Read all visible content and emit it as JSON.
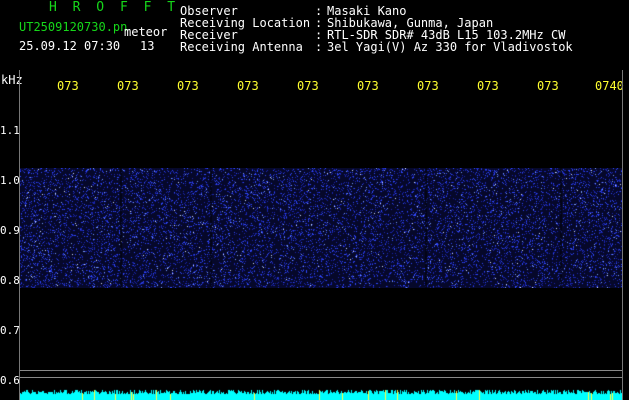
{
  "header": {
    "logo": "H R O F F T",
    "filename": "UT2509120730.pn",
    "meteor_label": "meteor",
    "date": "25.09.12 07:30",
    "count": "13",
    "info": [
      {
        "label": "Observer",
        "value": "Masaki Kano"
      },
      {
        "label": "Receiving Location",
        "value": "Shibukawa, Gunma, Japan"
      },
      {
        "label": "Receiver",
        "value": "RTL-SDR SDR# 43dB L15 103.2MHz CW"
      },
      {
        "label": "Receiving Antenna",
        "value": "3el Yagi(V) Az 330 for Vladivostok"
      }
    ]
  },
  "axes": {
    "unit": "kHz",
    "time_ticks": [
      "073",
      "073",
      "073",
      "073",
      "073",
      "073",
      "073",
      "073",
      "073",
      "0740"
    ],
    "freq_ticks": [
      "1.1",
      "1.0",
      "0.9",
      "0.8",
      "0.7",
      "0.6"
    ]
  },
  "colors": {
    "background": "#000000",
    "header_green": "#16d71a",
    "header_white": "#ffffff",
    "tick_yellow": "#ffff30",
    "noise_blue": "#2a3cff",
    "bottom_cyan": "#00ffff"
  }
}
